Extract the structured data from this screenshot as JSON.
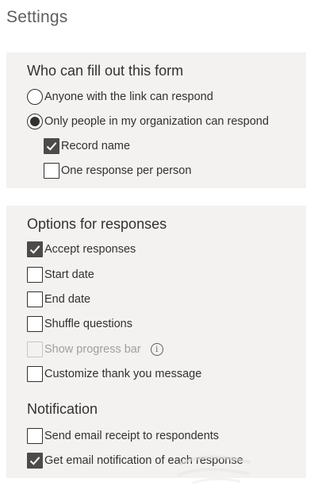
{
  "page": {
    "title": "Settings"
  },
  "who": {
    "title": "Who can fill out this form",
    "options": [
      {
        "label": "Anyone with the link can respond",
        "selected": false
      },
      {
        "label": "Only people in my organization can respond",
        "selected": true
      }
    ],
    "sub_options": [
      {
        "label": "Record name",
        "checked": true
      },
      {
        "label": "One response per person",
        "checked": false
      }
    ]
  },
  "options": {
    "title": "Options for responses",
    "items": [
      {
        "label": "Accept responses",
        "checked": true,
        "disabled": false
      },
      {
        "label": "Start date",
        "checked": false,
        "disabled": false
      },
      {
        "label": "End date",
        "checked": false,
        "disabled": false
      },
      {
        "label": "Shuffle questions",
        "checked": false,
        "disabled": false
      },
      {
        "label": "Show progress bar",
        "checked": false,
        "disabled": true,
        "icon": "info-icon"
      },
      {
        "label": "Customize thank you message",
        "checked": false,
        "disabled": false
      }
    ]
  },
  "notification": {
    "title": "Notification",
    "items": [
      {
        "label": "Send email receipt to respondents",
        "checked": false
      },
      {
        "label": "Get email notification of each response",
        "checked": true
      }
    ]
  },
  "colors": {
    "panel_bg": "#f3f2f1",
    "checked_fill": "#4d4b49",
    "text": "#323130",
    "disabled_text": "#a19f9d"
  }
}
